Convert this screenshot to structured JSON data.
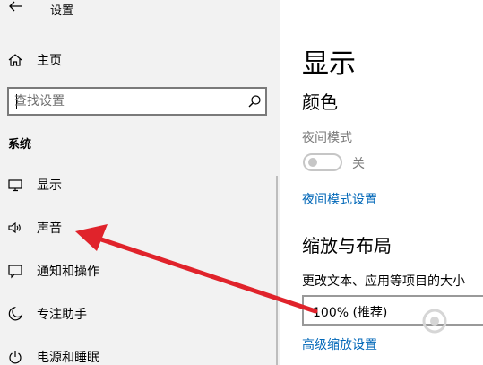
{
  "window": {
    "title": "设置"
  },
  "sidebar": {
    "home_label": "主页",
    "search_placeholder": "查找设置",
    "section_label": "系统",
    "items": [
      {
        "label": "显示",
        "icon": "monitor-icon"
      },
      {
        "label": "声音",
        "icon": "speaker-icon"
      },
      {
        "label": "通知和操作",
        "icon": "notification-icon"
      },
      {
        "label": "专注助手",
        "icon": "moon-icon"
      },
      {
        "label": "电源和睡眠",
        "icon": "power-icon"
      }
    ]
  },
  "main": {
    "title": "显示",
    "color_heading": "颜色",
    "night_mode_label": "夜间模式",
    "night_mode_state": "关",
    "night_mode_settings_link": "夜间模式设置",
    "scale_heading": "缩放与布局",
    "scale_description": "更改文本、应用等项目的大小",
    "scale_value": "100% (推荐)",
    "advanced_scale_link": "高级缩放设置"
  },
  "annotation": {
    "arrow_color": "#e0232b"
  },
  "colors": {
    "accent": "#0067b8",
    "sidebar_bg": "#f2f2f2"
  }
}
